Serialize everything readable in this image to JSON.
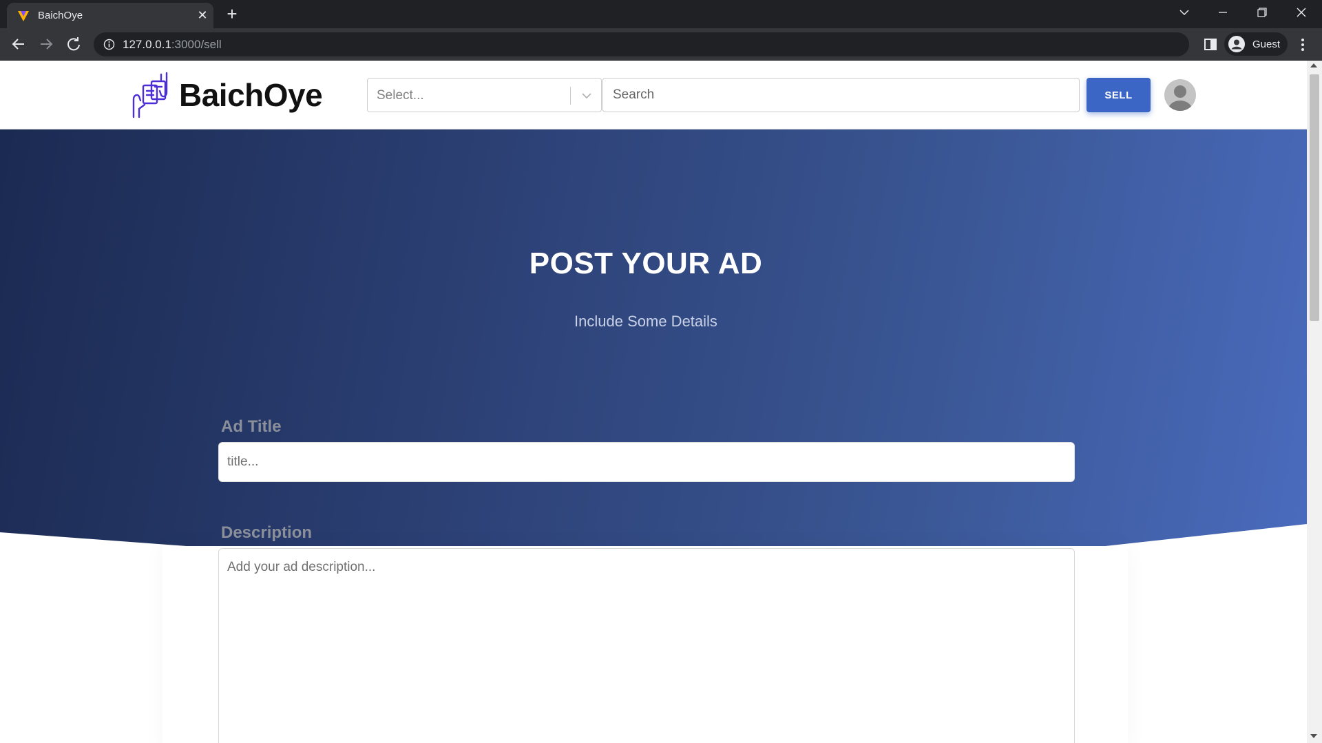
{
  "browser": {
    "tab_title": "BaichOye",
    "url_host": "127.0.0.1",
    "url_path": ":3000/sell",
    "profile_name": "Guest"
  },
  "navbar": {
    "brand": "BaichOye",
    "category_placeholder": "Select...",
    "search_placeholder": "Search",
    "sell_label": "SELL"
  },
  "hero": {
    "title": "POST YOUR AD",
    "subtitle": "Include Some Details"
  },
  "form": {
    "title_label": "Ad Title",
    "title_placeholder": "title...",
    "description_label": "Description",
    "description_placeholder": "Add your ad description..."
  },
  "colors": {
    "accent": "#3b66c6",
    "brand_icon": "#4b2ed6",
    "hero_start": "#1b2a52",
    "hero_end": "#4a6bbd"
  },
  "icons": [
    "favicon-icon",
    "close-icon",
    "plus-icon",
    "chevron-down-icon",
    "minimize-icon",
    "maximize-icon",
    "back-icon",
    "forward-icon",
    "reload-icon",
    "info-icon",
    "side-panel-icon",
    "profile-icon",
    "kebab-menu-icon",
    "brand-logo-icon",
    "user-avatar-icon"
  ]
}
